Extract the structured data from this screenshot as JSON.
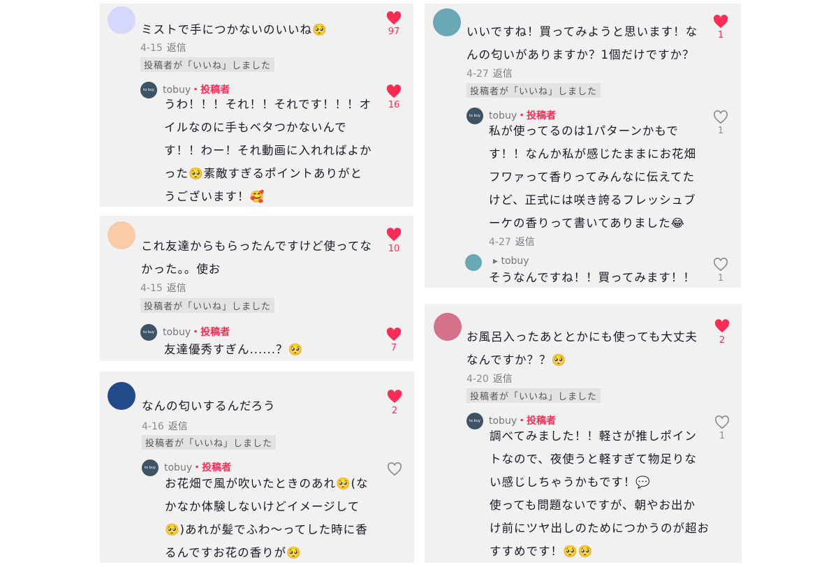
{
  "colors": {
    "accent": "#fe2c55",
    "card_bg": "#f1f1f2",
    "liked_badge_bg": "#e3e3e4"
  },
  "reply_label": "返信",
  "liked_by_author": "投稿者が「いいね」しました",
  "author_name": "tobuy",
  "author_badge": "・投稿者",
  "author_avatar_text": "to buy",
  "cards": [
    {
      "text_lines": [
        "ミストで手につかないのいいね🥺"
      ],
      "date": "4-15",
      "likes": "97",
      "reply": {
        "text_lines": [
          "うわ！！！それ！！それです！！！オ",
          "イルなのに手もベタつかないんで",
          "す！！わー！それ動画に入れればよか",
          "った🥺素敵すぎるポイントありがと",
          "うございます！🥰"
        ],
        "likes": "16"
      }
    },
    {
      "text_lines": [
        "これ友達からもらったんですけど使ってな",
        "かった。。使お"
      ],
      "date": "4-15",
      "likes": "10",
      "reply": {
        "text_lines": [
          "友達優秀すぎん......？🥺"
        ],
        "likes": "7"
      }
    },
    {
      "text_lines": [
        "なんの匂いするんだろう"
      ],
      "date": "4-16",
      "likes": "2",
      "reply": {
        "text_lines": [
          "お花畑で風が吹いたときのあれ🥺(な",
          "かなか体験しないけどイメージして",
          "🥺)あれが髪でふわ〜ってした時に香",
          "るんですお花の香りが🥺"
        ],
        "likes": ""
      }
    },
    {
      "text_lines": [
        "いいですね！買ってみようと思います！な",
        "んの匂いがありますか？1個だけですか？"
      ],
      "date": "4-27",
      "likes": "1",
      "reply": {
        "text_lines": [
          "私が使ってるのは1パターンかもで",
          "す！！なんか私が感じたままにお花畑",
          "フワァって香りってみんなに伝えてた",
          "けど、正式には咲き誇るフレッシュブ",
          "ーケの香りって書いてありました😂"
        ],
        "date": "4-27",
        "likes": "1"
      },
      "reply2": {
        "name": "▸ tobuy",
        "text_lines": [
          "そうなんですね！！買ってみます！！"
        ],
        "likes": "1"
      }
    },
    {
      "text_lines": [
        "お風呂入ったあととかにも使っても大丈夫",
        "なんですか？？🥺"
      ],
      "date": "4-20",
      "likes": "2",
      "reply": {
        "text_lines": [
          "調べてみました！！軽さが推しポイン",
          "トなので、夜使うと軽すぎて物足りな",
          "い感じしちゃうかもです！💬",
          "使っても問題ないですが、朝やお出か",
          "け前にツヤ出しのためにつかうのが超お",
          "すすめです！🥺🥺"
        ],
        "likes": "1"
      }
    }
  ]
}
